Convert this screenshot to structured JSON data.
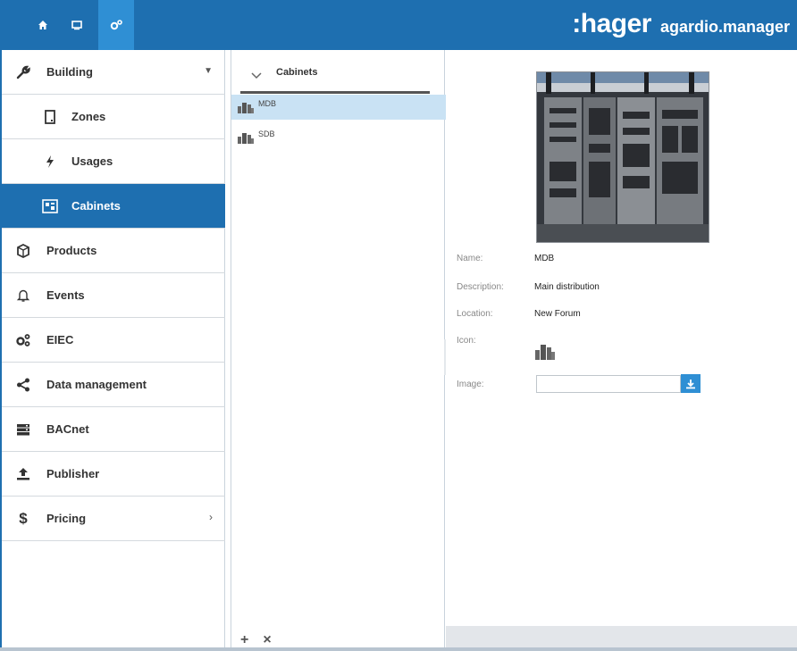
{
  "topbar": {
    "buttons": [
      {
        "icon": "home-icon"
      },
      {
        "icon": "monitor-icon"
      },
      {
        "icon": "settings-gears-icon",
        "active": true
      }
    ],
    "brand": ":hager",
    "product": "agardio.manager",
    "colors": {
      "primary": "#1e6fb0",
      "active_button": "#2f8fd4"
    }
  },
  "sidebar": {
    "items": [
      {
        "label": "Building",
        "icon": "wrench-icon",
        "expanded": true
      },
      {
        "label": "Zones",
        "icon": "door-icon",
        "sub": true
      },
      {
        "label": "Usages",
        "icon": "lightning-icon",
        "sub": true
      },
      {
        "label": "Cabinets",
        "icon": "cabinet-icon",
        "sub": true,
        "active": true
      },
      {
        "label": "Products",
        "icon": "cube-icon"
      },
      {
        "label": "Events",
        "icon": "bell-icon"
      },
      {
        "label": "EIEC",
        "icon": "gears-icon"
      },
      {
        "label": "Data management",
        "icon": "share-icon"
      },
      {
        "label": "BACnet",
        "icon": "server-icon"
      },
      {
        "label": "Publisher",
        "icon": "upload-icon"
      },
      {
        "label": "Pricing",
        "icon": "dollar-icon",
        "has_children": true
      }
    ]
  },
  "list": {
    "title": "Cabinets",
    "rows": [
      {
        "label": "MDB",
        "selected": true
      },
      {
        "label": "SDB",
        "selected": false
      }
    ],
    "footer": {
      "add": "+",
      "remove": "×"
    }
  },
  "detail": {
    "fields": {
      "name": {
        "label": "Name:",
        "value": "MDB"
      },
      "description": {
        "label": "Description:",
        "value": "Main distribution"
      },
      "location": {
        "label": "Location:",
        "value": "New Forum"
      },
      "icon": {
        "label": "Icon:"
      },
      "image": {
        "label": "Image:",
        "value": ""
      }
    }
  }
}
